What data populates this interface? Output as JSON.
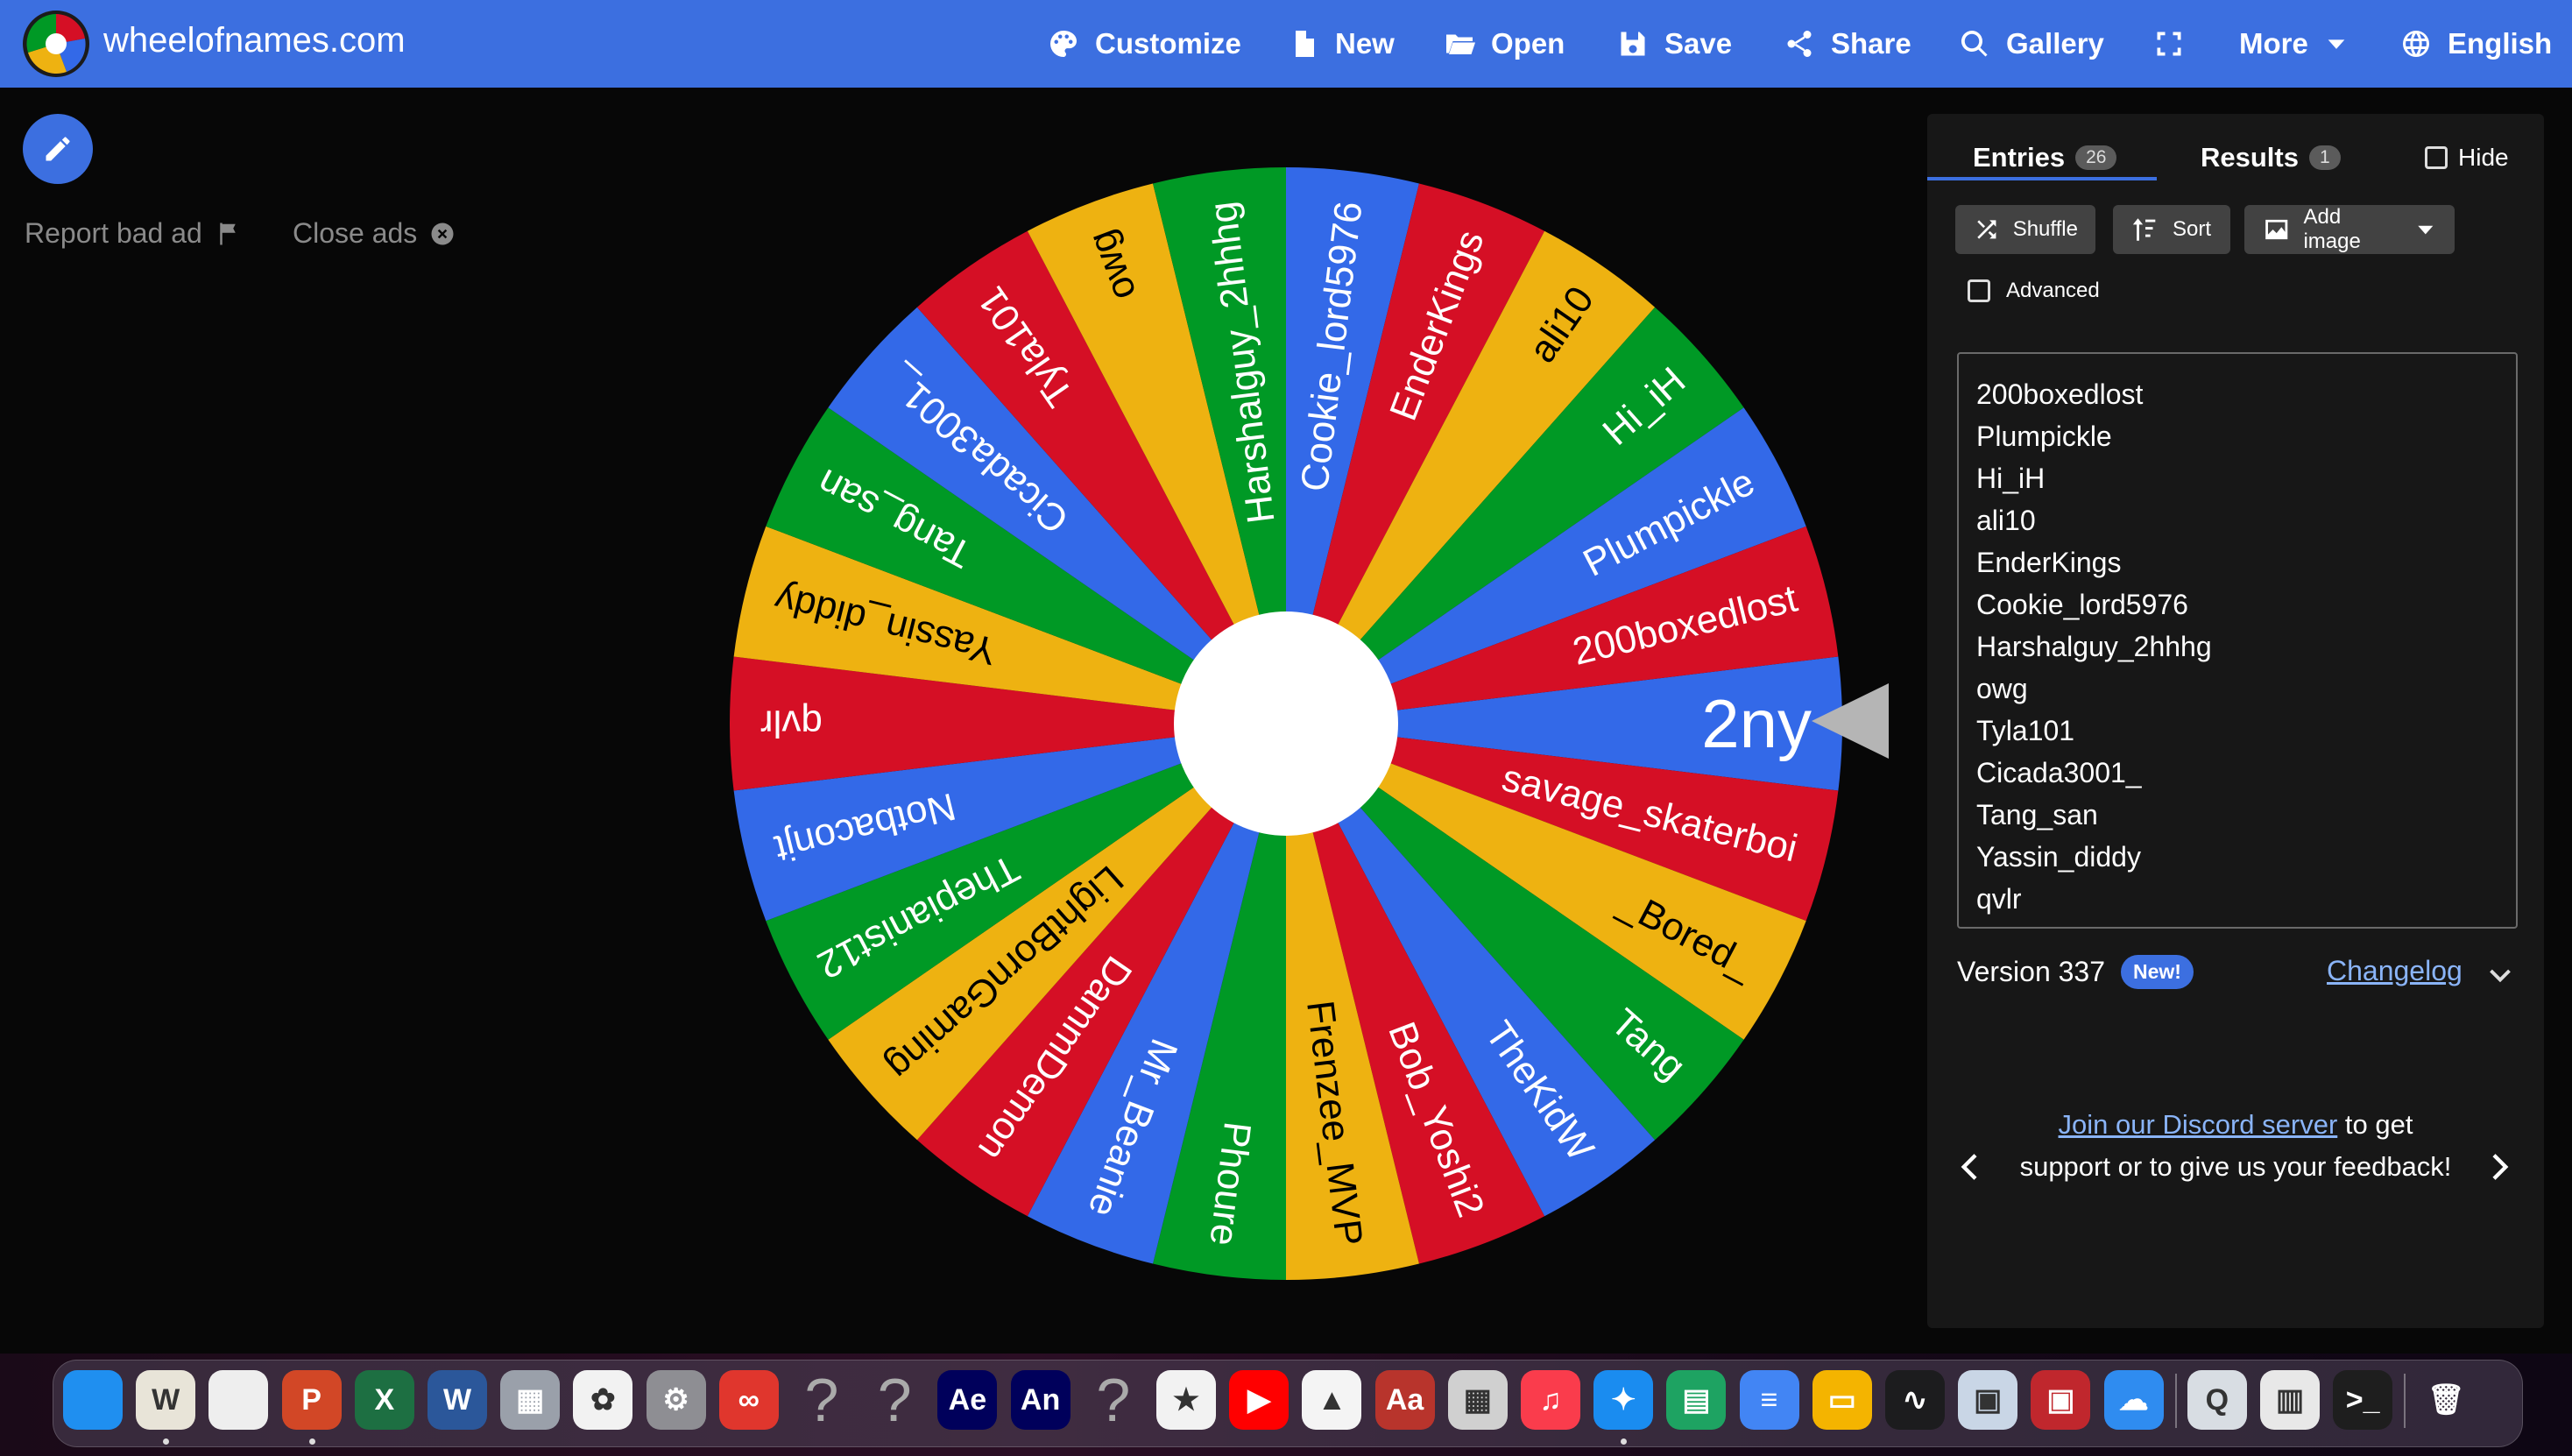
{
  "brand": {
    "name": "wheelofnames.com"
  },
  "nav": [
    {
      "label": "Customize",
      "icon": "palette-icon"
    },
    {
      "label": "New",
      "icon": "new-file-icon"
    },
    {
      "label": "Open",
      "icon": "folder-open-icon"
    },
    {
      "label": "Save",
      "icon": "save-icon"
    },
    {
      "label": "Share",
      "icon": "share-icon"
    },
    {
      "label": "Gallery",
      "icon": "search-icon"
    },
    {
      "label": "",
      "icon": "fullscreen-icon"
    },
    {
      "label": "More",
      "icon": "chevron-down-icon"
    },
    {
      "label": "English",
      "icon": "globe-icon"
    }
  ],
  "ads": {
    "report_label": "Report bad ad",
    "close_label": "Close ads"
  },
  "wheel": {
    "colors": [
      "#3369e8",
      "#d50f25",
      "#eeb211",
      "#009925"
    ],
    "selected": "2ny",
    "slices": [
      "2ny",
      "savage_skaterboi",
      "_Bored_",
      "Tang",
      "TheKidW",
      "Bob_Yoshi2",
      "Frenzee_MVP",
      "Phoure",
      "Mr_Beanie",
      "DammDemon",
      "LightBornGaming",
      "Thepianist12",
      "Notbaconjt",
      "qvlr",
      "Yassin_diddy",
      "Tang_san",
      "Cicada3001_",
      "Tyla101",
      "owg",
      "Harshalguy_2hhhg",
      "Cookie_lord5976",
      "EnderKings",
      "ali10",
      "Hi_iH",
      "Plumpickle",
      "200boxedlost"
    ]
  },
  "panel": {
    "tabs": {
      "entries_label": "Entries",
      "entries_count": "26",
      "results_label": "Results",
      "results_count": "1",
      "hide_label": "Hide"
    },
    "tools": {
      "shuffle": "Shuffle",
      "sort": "Sort",
      "add_image": "Add image",
      "advanced": "Advanced"
    },
    "entries": [
      "200boxedlost",
      "Plumpickle",
      "Hi_iH",
      "ali10",
      "EnderKings",
      "Cookie_lord5976",
      "Harshalguy_2hhhg",
      "owg",
      "Tyla101",
      "Cicada3001_",
      "Tang_san",
      "Yassin_diddy",
      "qvlr"
    ],
    "version_label": "Version 337",
    "new_badge": "New!",
    "changelog": "Changelog",
    "discord_link": "Join our Discord server",
    "discord_text": " to get support or to give us your feedback!"
  },
  "dock": {
    "apps": [
      {
        "name": "finder-icon",
        "color": "#1f8ff0",
        "glyph": ""
      },
      {
        "name": "w-app-icon",
        "color": "#e8e4d8",
        "glyph": "W"
      },
      {
        "name": "chrome-icon",
        "color": "#eeeeee",
        "glyph": ""
      },
      {
        "name": "powerpoint-icon",
        "color": "#d24726",
        "glyph": "P"
      },
      {
        "name": "excel-icon",
        "color": "#1d6f42",
        "glyph": "X"
      },
      {
        "name": "word-icon",
        "color": "#2b579a",
        "glyph": "W"
      },
      {
        "name": "launchpad-icon",
        "color": "#9aa0aa",
        "glyph": "▦"
      },
      {
        "name": "photos-icon",
        "color": "#f2f2f2",
        "glyph": "✿"
      },
      {
        "name": "system-settings-icon",
        "color": "#8e8e93",
        "glyph": "⚙"
      },
      {
        "name": "creative-cloud-icon",
        "color": "#e0362d",
        "glyph": "∞"
      },
      {
        "name": "unknown-app-icon",
        "color": "transparent",
        "glyph": "?"
      },
      {
        "name": "unknown-app-icon",
        "color": "transparent",
        "glyph": "?"
      },
      {
        "name": "after-effects-icon",
        "color": "#00005b",
        "glyph": "Ae"
      },
      {
        "name": "animate-icon",
        "color": "#00005b",
        "glyph": "An"
      },
      {
        "name": "unknown-app-icon",
        "color": "transparent",
        "glyph": "?"
      },
      {
        "name": "imovie-icon",
        "color": "#f2f2f2",
        "glyph": "★"
      },
      {
        "name": "youtube-icon",
        "color": "#ff0000",
        "glyph": "▶"
      },
      {
        "name": "google-drive-icon",
        "color": "#f4f4f4",
        "glyph": "▲"
      },
      {
        "name": "dictionary-icon",
        "color": "#b8342c",
        "glyph": "Aa"
      },
      {
        "name": "calculator-icon",
        "color": "#d0d0d0",
        "glyph": "▦"
      },
      {
        "name": "music-icon",
        "color": "#fa3c4c",
        "glyph": "♫"
      },
      {
        "name": "safari-icon",
        "color": "#1a8cf0",
        "glyph": "✦"
      },
      {
        "name": "google-sheets-icon",
        "color": "#1ea362",
        "glyph": "▤"
      },
      {
        "name": "google-docs-icon",
        "color": "#4285f4",
        "glyph": "≡"
      },
      {
        "name": "google-slides-icon",
        "color": "#f4b400",
        "glyph": "▭"
      },
      {
        "name": "activity-monitor-icon",
        "color": "#1c1c1e",
        "glyph": "∿"
      },
      {
        "name": "preview-icon",
        "color": "#c9d6e6",
        "glyph": "▣"
      },
      {
        "name": "photo-booth-icon",
        "color": "#c0272d",
        "glyph": "▣"
      },
      {
        "name": "weather-icon",
        "color": "#2f8cf0",
        "glyph": "☁"
      },
      {
        "name": "quicktime-icon",
        "color": "#d8dde3",
        "glyph": "Q"
      },
      {
        "name": "printer-icon",
        "color": "#e8e8e8",
        "glyph": "▥"
      },
      {
        "name": "terminal-icon",
        "color": "#1e1e1e",
        "glyph": ">_"
      },
      {
        "name": "trash-icon",
        "color": "transparent",
        "glyph": "🗑"
      }
    ]
  }
}
